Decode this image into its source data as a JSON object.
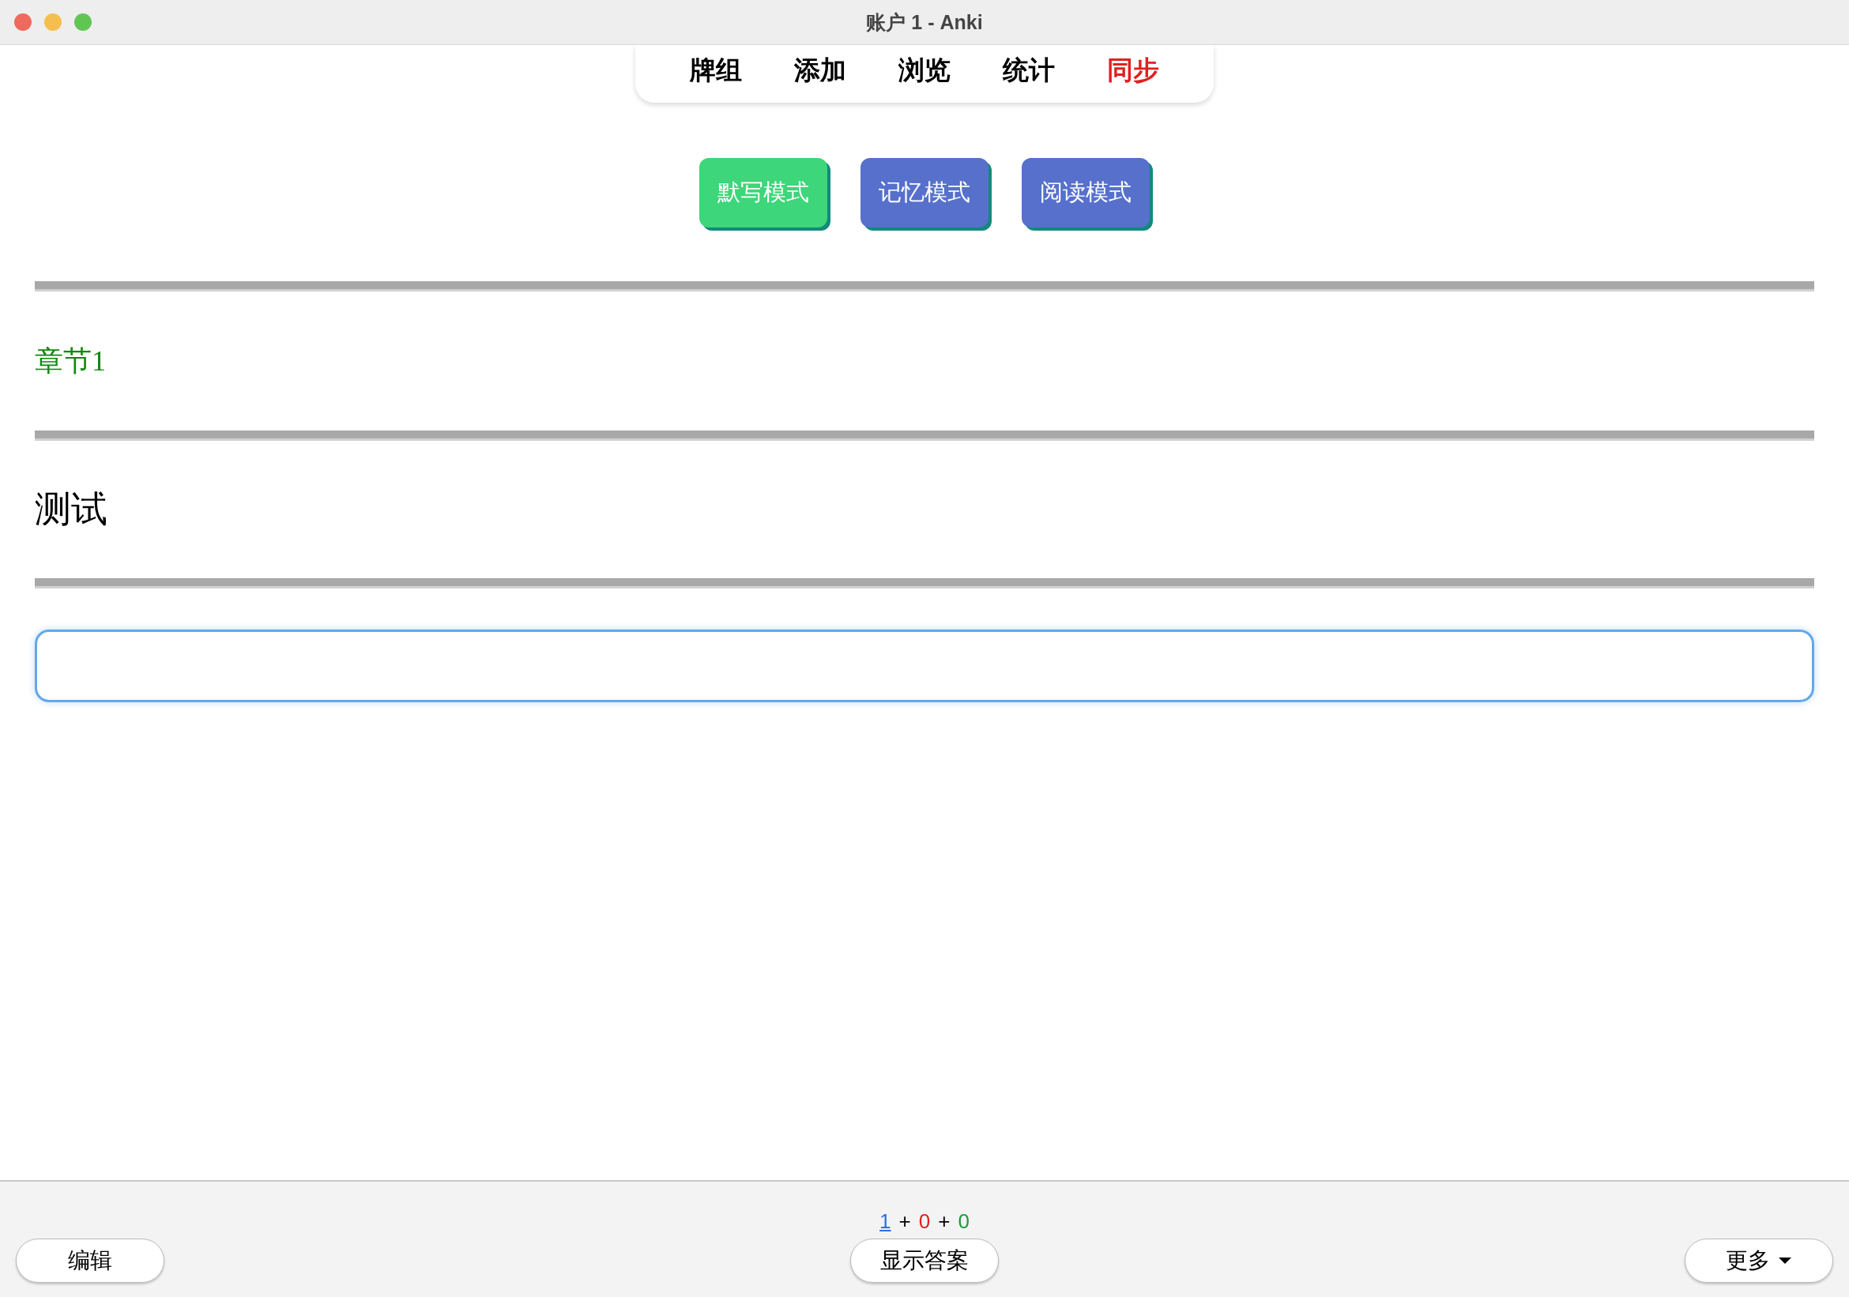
{
  "window": {
    "title": "账户 1 - Anki"
  },
  "nav": [
    {
      "label": "牌组",
      "color": "#000000"
    },
    {
      "label": "添加",
      "color": "#000000"
    },
    {
      "label": "浏览",
      "color": "#000000"
    },
    {
      "label": "统计",
      "color": "#000000"
    },
    {
      "label": "同步",
      "color": "#e02020"
    }
  ],
  "modes": [
    {
      "label": "默写模式",
      "selected": true
    },
    {
      "label": "记忆模式",
      "selected": false
    },
    {
      "label": "阅读模式",
      "selected": false
    }
  ],
  "chapter": "章节1",
  "question": "测试",
  "answer_field": {
    "focused": true
  },
  "counts": [
    {
      "text": "1",
      "color": "#2f6fe0",
      "selected": true
    },
    {
      "text": "+",
      "color": "#000000",
      "selected": false
    },
    {
      "text": "0",
      "color": "#e02020",
      "selected": false
    },
    {
      "text": "+",
      "color": "#000000",
      "selected": false
    },
    {
      "text": "0",
      "color": "#1a9a3a",
      "selected": false
    }
  ],
  "bottom": {
    "edit": "编辑",
    "show_answer": "显示答案",
    "more": "更多"
  }
}
